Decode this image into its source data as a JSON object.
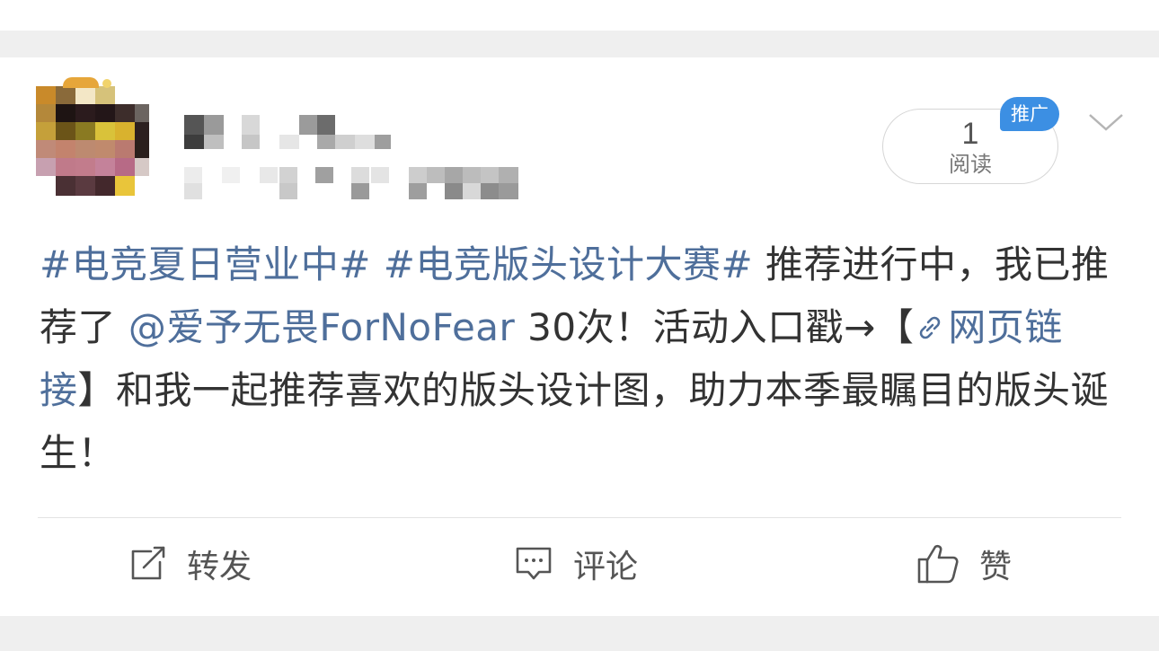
{
  "post": {
    "read_count": "1",
    "read_label": "阅读",
    "promo_badge": "推广",
    "text": {
      "topic1": "#电竞夏日营业中#",
      "topic2": "#电竞版头设计大赛#",
      "part1": " 推荐进行中，我已推荐了 ",
      "mention": "@爱予无畏ForNoFear",
      "part2": " 30次！活动入口戳→",
      "bracket_open": "【",
      "link_text": "网页链接",
      "bracket_close": "】",
      "part3": "和我一起推荐喜欢的版头设计图，助力本季最瞩目的版头诞生！"
    }
  },
  "actions": {
    "repost_label": "转发",
    "comment_label": "评论",
    "like_label": "赞"
  },
  "colors": {
    "link": "#4f6f9b",
    "badge": "#3c8fe3",
    "separator": "#efefef"
  },
  "icons": {
    "repost": "repost-icon",
    "comment": "comment-icon",
    "like": "thumbs-up-icon",
    "more": "chevron-down-icon",
    "link": "link-icon"
  }
}
